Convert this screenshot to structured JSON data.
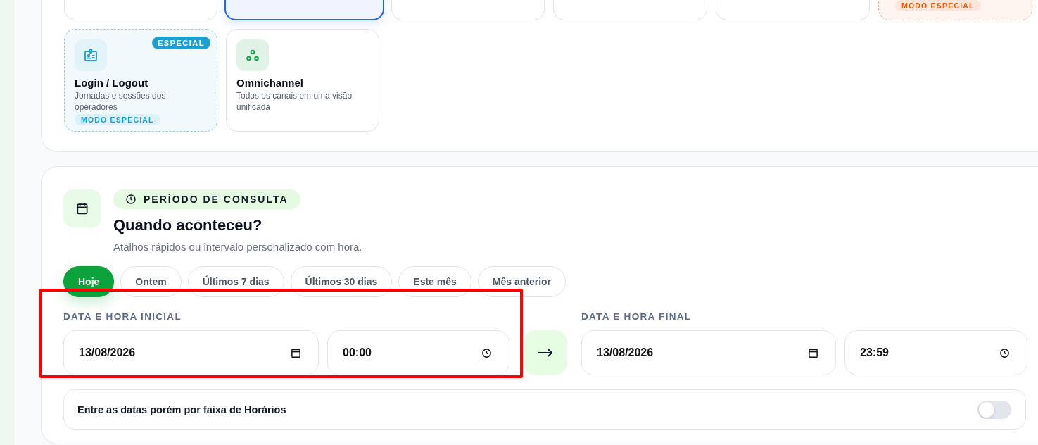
{
  "top_cards": [
    {
      "kind": "standard",
      "selected": false
    },
    {
      "kind": "standard",
      "selected": true
    },
    {
      "kind": "standard",
      "selected": false
    },
    {
      "kind": "standard",
      "selected": false
    },
    {
      "kind": "standard",
      "selected": false
    },
    {
      "kind": "special",
      "selected": false,
      "color": "#ea580c",
      "badge": "MODO ESPECIAL"
    }
  ],
  "cards": [
    {
      "kind": "special",
      "selected": false,
      "color": "#1e9fd0",
      "corner_badge": "ESPECIAL",
      "title": "Login / Logout",
      "description": "Jornadas e sessões dos operadores",
      "badge": "MODO ESPECIAL"
    },
    {
      "kind": "standard",
      "selected": false,
      "color": "#16a34a",
      "title": "Omnichannel",
      "description": "Todos os canais em uma visão unificada"
    }
  ],
  "period": {
    "tag": "PERÍODO DE CONSULTA",
    "title": "Quando aconteceu?",
    "subtitle": "Atalhos rápidos ou intervalo personalizado com hora.",
    "presets": [
      {
        "label": "Hoje",
        "selected": true
      },
      {
        "label": "Ontem",
        "selected": false
      },
      {
        "label": "Últimos 7 dias",
        "selected": false
      },
      {
        "label": "Últimos 30 dias",
        "selected": false
      },
      {
        "label": "Este mês",
        "selected": false
      },
      {
        "label": "Mês anterior",
        "selected": false
      }
    ],
    "start": {
      "label": "DATA E HORA INICIAL",
      "date": "13/08/2026",
      "time": "00:00",
      "highlighted": true
    },
    "end": {
      "label": "DATA E HORA FINAL",
      "date": "13/08/2026",
      "time": "23:59",
      "highlighted": false
    },
    "time_range": {
      "label": "Entre as datas porém por faixa de Horários",
      "on": false
    }
  }
}
